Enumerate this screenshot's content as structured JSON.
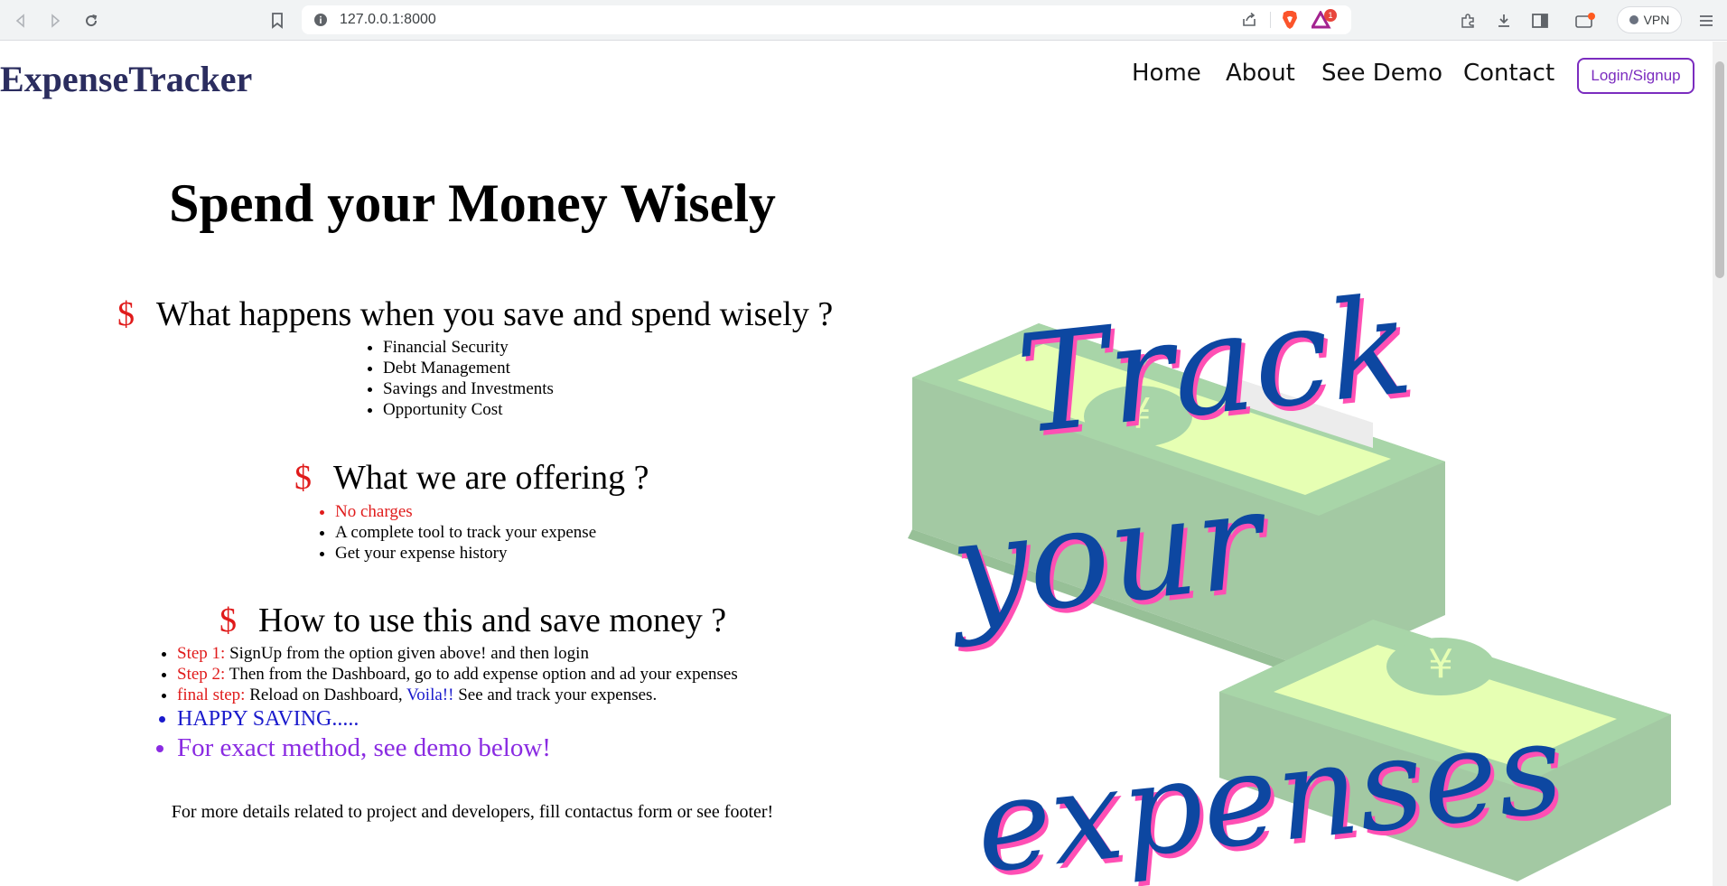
{
  "browser": {
    "url": "127.0.0.1:8000",
    "vpn_label": "VPN",
    "alert_badge": "1"
  },
  "header": {
    "logo": "ExpenseTracker",
    "nav": [
      "Home",
      "About",
      "See Demo",
      "Contact"
    ],
    "login_label": "Login/Signup"
  },
  "hero": {
    "title": "Spend your Money Wisely",
    "symbol": "$",
    "section1": {
      "heading": "What happens when you save and spend wisely ?",
      "items": [
        "Financial Security",
        "Debt Management",
        "Savings and Investments",
        "Opportunity Cost"
      ]
    },
    "section2": {
      "heading": "What we are offering ?",
      "items": [
        "No charges",
        "A complete tool to track your expense",
        "Get your expense history"
      ]
    },
    "section3": {
      "heading": "How to use this and save money ?",
      "steps": [
        {
          "label": "Step 1:",
          "text": "SignUp from the option given above! and then login"
        },
        {
          "label": "Step 2:",
          "text": "Then from the Dashboard, go to add expense option and ad your expenses"
        },
        {
          "label": "final step:",
          "text_before": "Reload on Dashboard,",
          "highlight": "Voila!!",
          "text_after": "See and track your expenses."
        }
      ],
      "happy": "HAPPY SAVING.....",
      "demo": "For exact method, see demo below!"
    },
    "footer_note": "For more details related to project and developers, fill contactus form or see footer!"
  },
  "illustration": {
    "lines": [
      "Track",
      "your",
      "expenses"
    ],
    "currency_symbol": "¥",
    "text_color": "#0d47a1",
    "shadow_color": "#ff4fb4",
    "money_color": "#a8d5a8",
    "bill_face": "#e6ffb3"
  }
}
